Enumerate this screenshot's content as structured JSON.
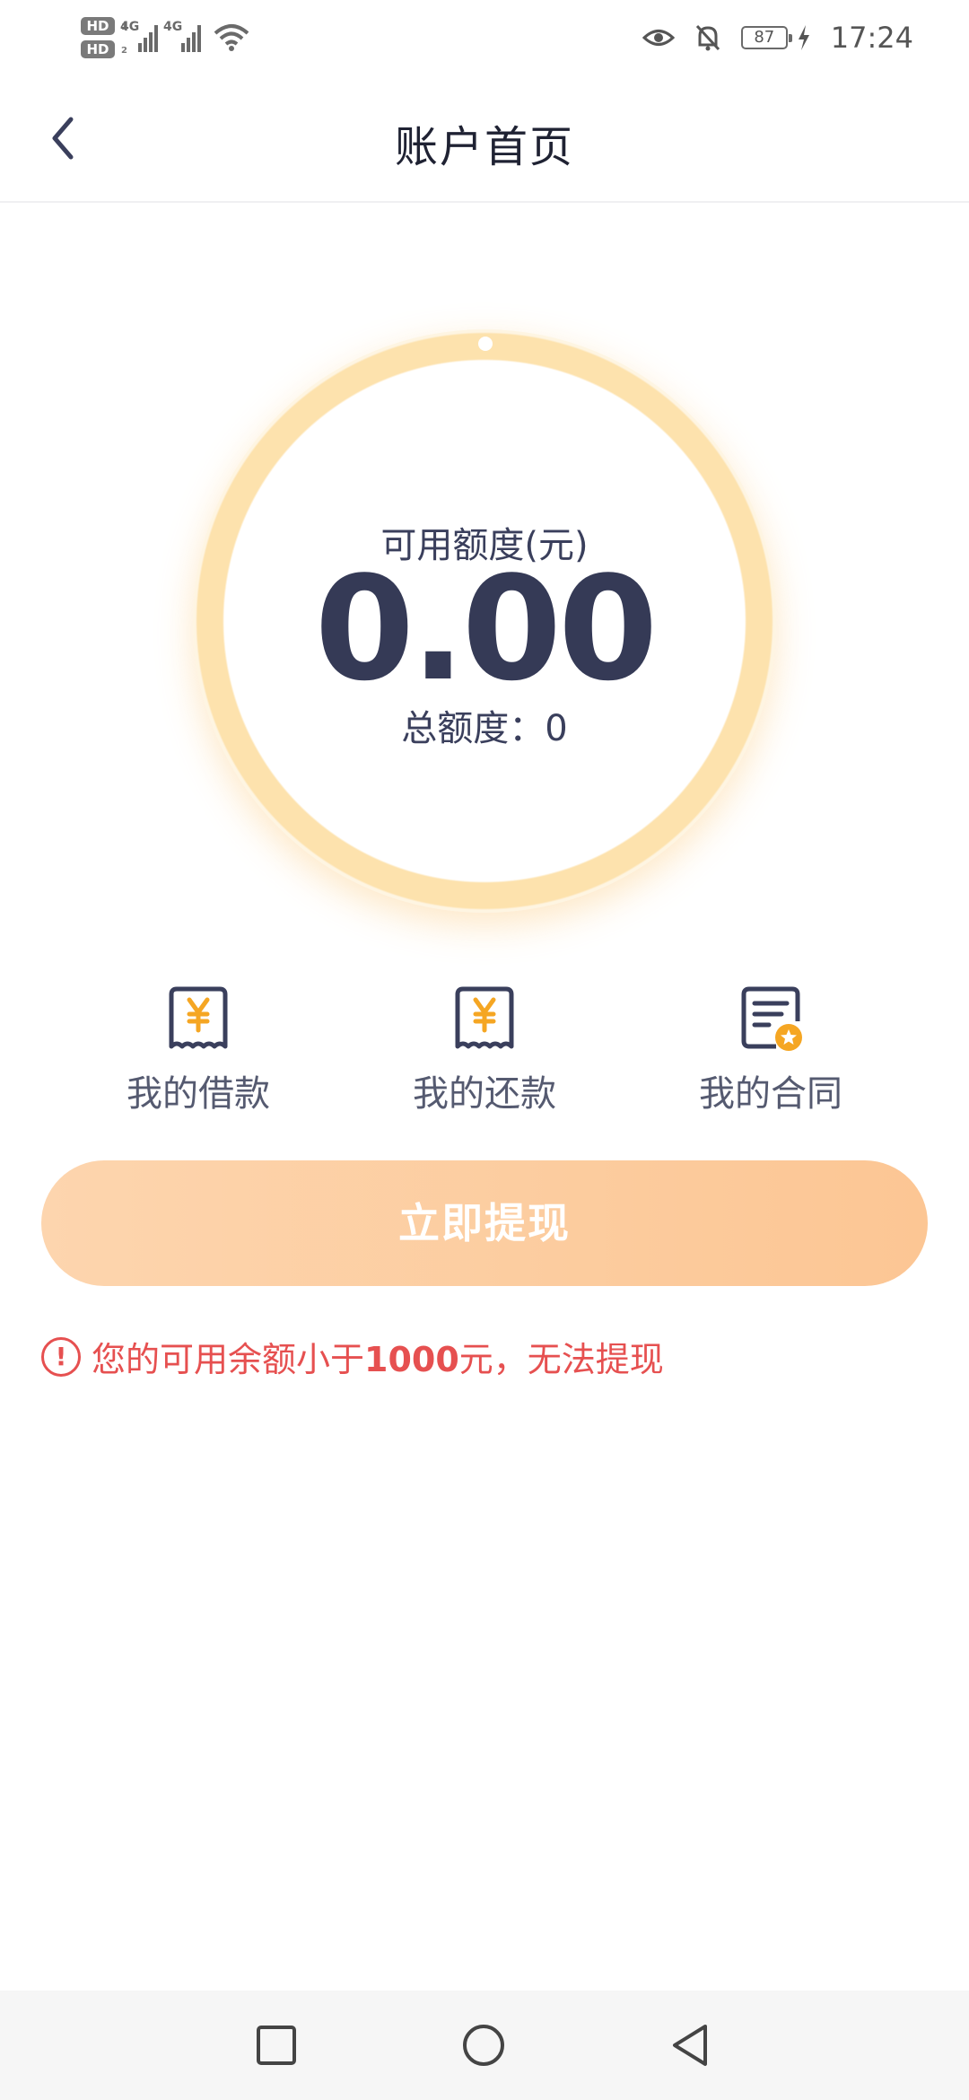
{
  "status_bar": {
    "sim1": "HD",
    "sim1_index": "1",
    "sim2": "HD",
    "sim2_index": "2",
    "network1": "4G",
    "network2": "4G",
    "battery": "87",
    "time": "17:24",
    "icons": [
      "eye-icon",
      "bell-off-icon",
      "battery-icon",
      "charging-icon",
      "wifi-icon"
    ]
  },
  "header": {
    "title": "账户首页",
    "back_icon": "chevron-left-icon"
  },
  "credit": {
    "available_label": "可用额度(元)",
    "available_value": "0.00",
    "total_label": "总额度：",
    "total_value": "0"
  },
  "shortcuts": [
    {
      "label": "我的借款",
      "icon": "yuan-receipt-icon"
    },
    {
      "label": "我的还款",
      "icon": "yuan-receipt-icon"
    },
    {
      "label": "我的合同",
      "icon": "contract-icon"
    }
  ],
  "withdraw_button": "立即提现",
  "warning": {
    "prefix": "您的可用余额小于",
    "amount": "1000",
    "suffix": "元，无法提现"
  },
  "colors": {
    "primary_text": "#353a56",
    "ring": "#fde2ad",
    "button_start": "#fdd5ae",
    "button_end": "#fcc694",
    "warning": "#e65050",
    "icon_accent": "#f5a623"
  }
}
